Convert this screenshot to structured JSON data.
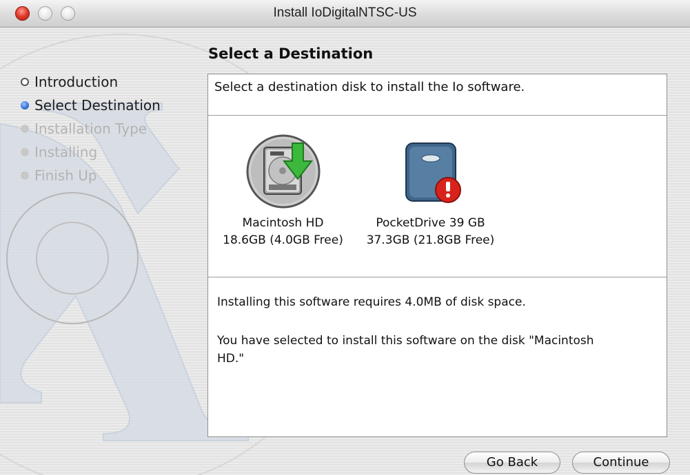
{
  "window": {
    "title": "Install IoDigitalNTSC-US"
  },
  "sidebar": {
    "steps": [
      {
        "label": "Introduction",
        "state": "done"
      },
      {
        "label": "Select Destination",
        "state": "current"
      },
      {
        "label": "Installation Type",
        "state": "future"
      },
      {
        "label": "Installing",
        "state": "future"
      },
      {
        "label": "Finish Up",
        "state": "future"
      }
    ]
  },
  "main": {
    "heading": "Select a Destination",
    "instruction": "Select a destination disk to install the Io software.",
    "disks": [
      {
        "name": "Macintosh HD",
        "size": "18.6GB (4.0GB Free)",
        "icon": "hard-disk-install-icon",
        "selected": true
      },
      {
        "name": "PocketDrive 39 GB",
        "size": "37.3GB (21.8GB Free)",
        "icon": "external-drive-warning-icon",
        "selected": false
      }
    ],
    "space_required": "Installing this software requires 4.0MB of disk space.",
    "selection_message_line1": "You have selected to install this software on the disk \"Macintosh",
    "selection_message_line2": "HD.\""
  },
  "buttons": {
    "go_back": "Go Back",
    "continue": "Continue"
  },
  "colors": {
    "current_step": "#2f6fd6",
    "future_step": "#b3b3b3",
    "install_arrow": "#3cb83c",
    "warning": "#d8231c"
  }
}
